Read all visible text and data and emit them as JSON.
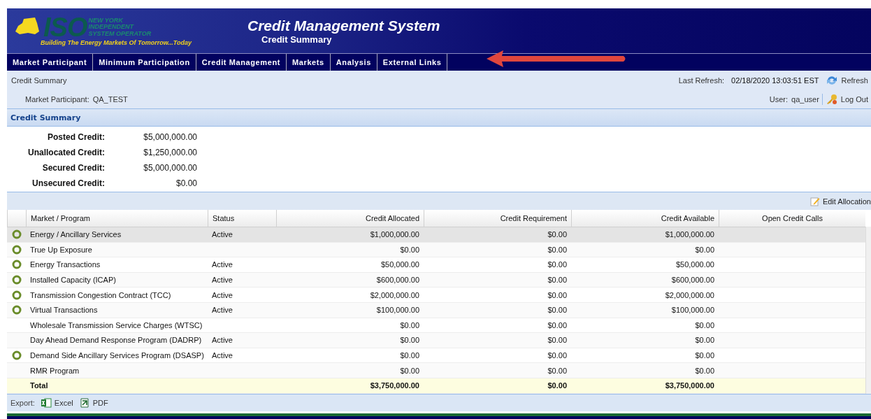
{
  "header": {
    "logo": {
      "mark": "ISO",
      "name_lines": [
        "NEW YORK",
        "INDEPENDENT",
        "SYSTEM OPERATOR"
      ],
      "tagline": "Building The Energy Markets Of Tomorrow...Today"
    },
    "title": "Credit Management System",
    "subtitle": "Credit Summary"
  },
  "nav": [
    "Market Participant",
    "Minimum Participation",
    "Credit Management",
    "Markets",
    "Analysis",
    "External Links"
  ],
  "info": {
    "breadcrumb": "Credit Summary",
    "refresh_label": "Last Refresh:",
    "refresh_time": "02/18/2020 13:03:51 EST",
    "refresh_button": "Refresh",
    "participant_label": "Market Participant:",
    "participant": "QA_TEST",
    "user_label": "User:",
    "user": "qa_user",
    "logout": "Log Out"
  },
  "section_title": "Credit Summary",
  "summary": [
    {
      "label": "Posted Credit:",
      "value": "$5,000,000.00"
    },
    {
      "label": "Unallocated Credit:",
      "value": "$1,250,000.00"
    },
    {
      "label": "Secured Credit:",
      "value": "$5,000,000.00"
    },
    {
      "label": "Unsecured Credit:",
      "value": "$0.00"
    }
  ],
  "edit_allocation": "Edit Allocation",
  "table": {
    "columns": [
      "Market / Program",
      "Status",
      "Credit Allocated",
      "Credit Requirement",
      "Credit Available",
      "Open Credit Calls"
    ],
    "rows": [
      {
        "indicator": true,
        "selected": true,
        "cells": [
          "Energy / Ancillary Services",
          "Active",
          "$1,000,000.00",
          "$0.00",
          "$1,000,000.00"
        ]
      },
      {
        "indicator": true,
        "selected": false,
        "cells": [
          "True Up Exposure",
          "",
          "$0.00",
          "$0.00",
          "$0.00"
        ]
      },
      {
        "indicator": true,
        "selected": false,
        "cells": [
          "Energy Transactions",
          "Active",
          "$50,000.00",
          "$0.00",
          "$50,000.00"
        ]
      },
      {
        "indicator": true,
        "selected": false,
        "cells": [
          "Installed Capacity (ICAP)",
          "Active",
          "$600,000.00",
          "$0.00",
          "$600,000.00"
        ]
      },
      {
        "indicator": true,
        "selected": false,
        "cells": [
          "Transmission Congestion Contract (TCC)",
          "Active",
          "$2,000,000.00",
          "$0.00",
          "$2,000,000.00"
        ]
      },
      {
        "indicator": true,
        "selected": false,
        "cells": [
          "Virtual Transactions",
          "Active",
          "$100,000.00",
          "$0.00",
          "$100,000.00"
        ]
      },
      {
        "indicator": false,
        "selected": false,
        "cells": [
          "Wholesale Transmission Service Charges (WTSC)",
          "",
          "$0.00",
          "$0.00",
          "$0.00"
        ]
      },
      {
        "indicator": false,
        "selected": false,
        "cells": [
          "Day Ahead Demand Response Program (DADRP)",
          "Active",
          "$0.00",
          "$0.00",
          "$0.00"
        ]
      },
      {
        "indicator": true,
        "selected": false,
        "cells": [
          "Demand Side Ancillary Services Program (DSASP)",
          "Active",
          "$0.00",
          "$0.00",
          "$0.00"
        ]
      },
      {
        "indicator": false,
        "selected": false,
        "cells": [
          "RMR Program",
          "",
          "$0.00",
          "$0.00",
          "$0.00"
        ]
      }
    ],
    "total": {
      "label": "Total",
      "values": [
        "$3,750,000.00",
        "$0.00",
        "$3,750,000.00"
      ]
    }
  },
  "export": {
    "label": "Export:",
    "buttons": [
      {
        "kind": "excel",
        "label": "Excel"
      },
      {
        "kind": "pdf",
        "label": "PDF"
      }
    ]
  }
}
